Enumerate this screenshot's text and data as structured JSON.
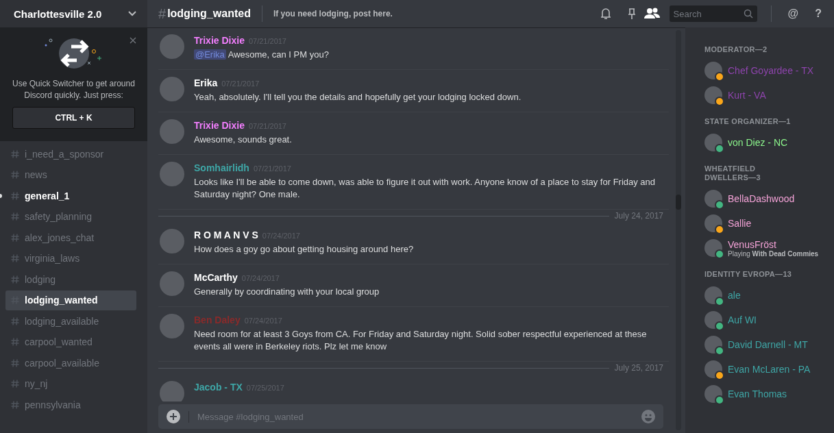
{
  "server": {
    "name": "Charlottesville 2.0"
  },
  "quick_switcher": {
    "text": "Use Quick Switcher to get around Discord quickly. Just press:",
    "shortcut": "CTRL + K"
  },
  "channels": [
    {
      "name": "i_need_a_sponsor",
      "selected": false,
      "unread": false
    },
    {
      "name": "news",
      "selected": false,
      "unread": false
    },
    {
      "name": "general_1",
      "selected": false,
      "unread": true
    },
    {
      "name": "safety_planning",
      "selected": false,
      "unread": false
    },
    {
      "name": "alex_jones_chat",
      "selected": false,
      "unread": false
    },
    {
      "name": "virginia_laws",
      "selected": false,
      "unread": false
    },
    {
      "name": "lodging",
      "selected": false,
      "unread": false
    },
    {
      "name": "lodging_wanted",
      "selected": true,
      "unread": false
    },
    {
      "name": "lodging_available",
      "selected": false,
      "unread": false
    },
    {
      "name": "carpool_wanted",
      "selected": false,
      "unread": false
    },
    {
      "name": "carpool_available",
      "selected": false,
      "unread": false
    },
    {
      "name": "ny_nj",
      "selected": false,
      "unread": false
    },
    {
      "name": "pennsylvania",
      "selected": false,
      "unread": false
    }
  ],
  "header": {
    "hash": "#",
    "channel": "lodging_wanted",
    "topic": "If you need lodging, post here.",
    "search_placeholder": "Search",
    "actions": [
      "@",
      "?"
    ]
  },
  "messages": [
    {
      "kind": "message",
      "author": "Trixie Dixie",
      "color": "#f47fff",
      "time": "07/21/2017",
      "mention": "@Erika",
      "text": "Awesome, can I PM you?"
    },
    {
      "kind": "message",
      "author": "Erika",
      "color": "#ffffff",
      "time": "07/21/2017",
      "text": "Yeah, absolutely. I'll tell you the details and hopefully get your lodging locked down."
    },
    {
      "kind": "message",
      "author": "Trixie Dixie",
      "color": "#f47fff",
      "time": "07/21/2017",
      "text": "Awesome, sounds great."
    },
    {
      "kind": "message",
      "author": "Somhairlidh",
      "color": "#3ea6a6",
      "time": "07/21/2017",
      "text": "Looks like I'll be able to come down, was able to figure it out with work. Anyone know of a place to stay for Friday and Saturday night? One male."
    },
    {
      "kind": "divider",
      "text": "July 24, 2017"
    },
    {
      "kind": "message",
      "author": "R O M A N V S",
      "color": "#ffffff",
      "time": "07/24/2017",
      "text": "How does a goy go about getting housing around here?"
    },
    {
      "kind": "message",
      "author": "McCarthy",
      "color": "#ffffff",
      "time": "07/24/2017",
      "text": "Generally by coordinating with your local group"
    },
    {
      "kind": "message",
      "author": "Ben Daley",
      "color": "#8a2a2a",
      "time": "07/24/2017",
      "text": "Need room for at least 3 Goys from CA. For Friday and Saturday night. Solid sober respectful experienced at these events all were in Berkeley riots. Plz let me know"
    },
    {
      "kind": "divider",
      "text": "July 25, 2017"
    },
    {
      "kind": "message",
      "author": "Jacob - TX",
      "color": "#3ea6a6",
      "time": "07/25/2017"
    }
  ],
  "composer": {
    "placeholder": "Message #lodging_wanted"
  },
  "member_groups": [
    {
      "title": "MODERATOR—2",
      "members": [
        {
          "name": "Chef Goyardee - TX",
          "color": "#8e44ad",
          "idle": true
        },
        {
          "name": "Kurt - VA",
          "color": "#8e44ad",
          "idle": true
        }
      ]
    },
    {
      "title": "STATE ORGANIZER—1",
      "members": [
        {
          "name": "von Diez - NC",
          "color": "#8cf58c",
          "idle": false
        }
      ]
    },
    {
      "title": "WHEATFIELD DWELLERS—3",
      "members": [
        {
          "name": "BellaDashwood",
          "color": "#f5a3d8",
          "idle": false
        },
        {
          "name": "Sallie",
          "color": "#f5a3d8",
          "idle": true
        },
        {
          "name": "VenusFröst",
          "color": "#f5a3d8",
          "idle": false,
          "activity": "Playing **With Dead Commies**"
        }
      ]
    },
    {
      "title": "IDENTITY EVROPA—13",
      "members": [
        {
          "name": "ale",
          "color": "#3ea6a6",
          "idle": false
        },
        {
          "name": "Auf WI",
          "color": "#3ea6a6",
          "idle": false
        },
        {
          "name": "David Darnell - MT",
          "color": "#3ea6a6",
          "idle": false
        },
        {
          "name": "Evan McLaren - PA",
          "color": "#3ea6a6",
          "idle": true
        },
        {
          "name": "Evan Thomas",
          "color": "#3ea6a6",
          "idle": false
        }
      ]
    }
  ]
}
